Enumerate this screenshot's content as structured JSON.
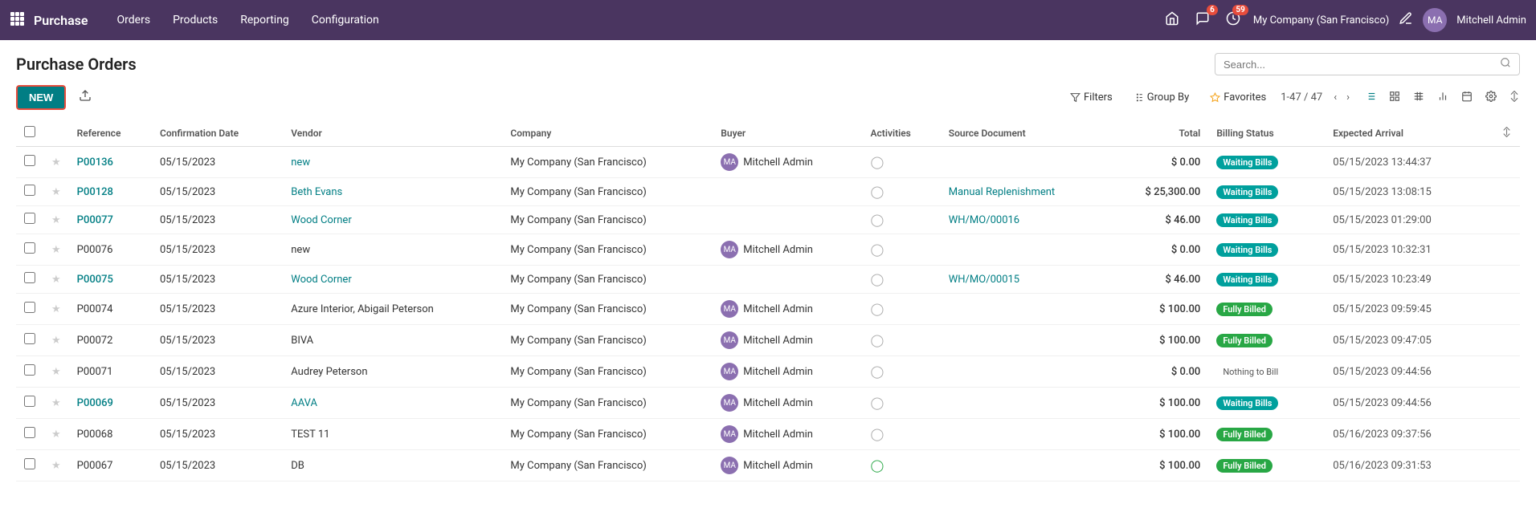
{
  "app": {
    "name": "Purchase",
    "nav_items": [
      "Orders",
      "Products",
      "Reporting",
      "Configuration"
    ]
  },
  "topnav": {
    "notification_count": "6",
    "activity_count": "59",
    "company": "My Company (San Francisco)",
    "username": "Mitchell Admin"
  },
  "page": {
    "title": "Purchase Orders",
    "search_placeholder": "Search..."
  },
  "toolbar": {
    "new_label": "NEW",
    "filters_label": "Filters",
    "group_by_label": "Group By",
    "favorites_label": "Favorites",
    "pagination": "1-47 / 47"
  },
  "table": {
    "columns": [
      "Reference",
      "Confirmation Date",
      "Vendor",
      "Company",
      "Buyer",
      "Activities",
      "Source Document",
      "Total",
      "Billing Status",
      "Expected Arrival"
    ],
    "rows": [
      {
        "ref": "P00136",
        "date": "05/15/2023",
        "vendor": "new",
        "company": "My Company (San Francisco)",
        "buyer": "Mitchell Admin",
        "has_avatar": true,
        "activities": "clock",
        "source": "",
        "total": "$ 0.00",
        "billing": "Waiting Bills",
        "billing_type": "waiting",
        "arrival": "05/15/2023 13:44:37",
        "ref_link": true,
        "vendor_link": true
      },
      {
        "ref": "P00128",
        "date": "05/15/2023",
        "vendor": "Beth Evans",
        "company": "My Company (San Francisco)",
        "buyer": "",
        "has_avatar": false,
        "activities": "clock",
        "source": "Manual Replenishment",
        "total": "$ 25,300.00",
        "billing": "Waiting Bills",
        "billing_type": "waiting",
        "arrival": "05/15/2023 13:08:15",
        "ref_link": true,
        "vendor_link": true
      },
      {
        "ref": "P00077",
        "date": "05/15/2023",
        "vendor": "Wood Corner",
        "company": "My Company (San Francisco)",
        "buyer": "",
        "has_avatar": false,
        "activities": "clock",
        "source": "WH/MO/00016",
        "total": "$ 46.00",
        "billing": "Waiting Bills",
        "billing_type": "waiting",
        "arrival": "05/15/2023 01:29:00",
        "ref_link": true,
        "vendor_link": true
      },
      {
        "ref": "P00076",
        "date": "05/15/2023",
        "vendor": "new",
        "company": "My Company (San Francisco)",
        "buyer": "Mitchell Admin",
        "has_avatar": true,
        "activities": "clock",
        "source": "",
        "total": "$ 0.00",
        "billing": "Waiting Bills",
        "billing_type": "waiting",
        "arrival": "05/15/2023 10:32:31",
        "ref_link": false,
        "vendor_link": false
      },
      {
        "ref": "P00075",
        "date": "05/15/2023",
        "vendor": "Wood Corner",
        "company": "My Company (San Francisco)",
        "buyer": "",
        "has_avatar": false,
        "activities": "clock",
        "source": "WH/MO/00015",
        "total": "$ 46.00",
        "billing": "Waiting Bills",
        "billing_type": "waiting",
        "arrival": "05/15/2023 10:23:49",
        "ref_link": true,
        "vendor_link": true
      },
      {
        "ref": "P00074",
        "date": "05/15/2023",
        "vendor": "Azure Interior, Abigail Peterson",
        "company": "My Company (San Francisco)",
        "buyer": "Mitchell Admin",
        "has_avatar": true,
        "activities": "clock",
        "source": "",
        "total": "$ 100.00",
        "billing": "Fully Billed",
        "billing_type": "billed",
        "arrival": "05/15/2023 09:59:45",
        "ref_link": false,
        "vendor_link": false
      },
      {
        "ref": "P00072",
        "date": "05/15/2023",
        "vendor": "BIVA",
        "company": "My Company (San Francisco)",
        "buyer": "Mitchell Admin",
        "has_avatar": true,
        "activities": "clock",
        "source": "",
        "total": "$ 100.00",
        "billing": "Fully Billed",
        "billing_type": "billed",
        "arrival": "05/15/2023 09:47:05",
        "ref_link": false,
        "vendor_link": false
      },
      {
        "ref": "P00071",
        "date": "05/15/2023",
        "vendor": "Audrey Peterson",
        "company": "My Company (San Francisco)",
        "buyer": "Mitchell Admin",
        "has_avatar": true,
        "activities": "clock",
        "source": "",
        "total": "$ 0.00",
        "billing": "Nothing to Bill",
        "billing_type": "nothing",
        "arrival": "05/15/2023 09:44:56",
        "ref_link": false,
        "vendor_link": false
      },
      {
        "ref": "P00069",
        "date": "05/15/2023",
        "vendor": "AAVA",
        "company": "My Company (San Francisco)",
        "buyer": "Mitchell Admin",
        "has_avatar": true,
        "activities": "clock",
        "source": "",
        "total": "$ 100.00",
        "billing": "Waiting Bills",
        "billing_type": "waiting",
        "arrival": "05/15/2023 09:44:56",
        "ref_link": true,
        "vendor_link": true
      },
      {
        "ref": "P00068",
        "date": "05/15/2023",
        "vendor": "TEST 11",
        "company": "My Company (San Francisco)",
        "buyer": "Mitchell Admin",
        "has_avatar": true,
        "activities": "clock",
        "source": "",
        "total": "$ 100.00",
        "billing": "Fully Billed",
        "billing_type": "billed",
        "arrival": "05/16/2023 09:37:56",
        "ref_link": false,
        "vendor_link": false
      },
      {
        "ref": "P00067",
        "date": "05/15/2023",
        "vendor": "DB",
        "company": "My Company (San Francisco)",
        "buyer": "Mitchell Admin",
        "has_avatar": true,
        "activities": "clock-green",
        "source": "",
        "total": "$ 100.00",
        "billing": "Fully Billed",
        "billing_type": "billed",
        "arrival": "05/16/2023 09:31:53",
        "ref_link": false,
        "vendor_link": false
      }
    ]
  }
}
